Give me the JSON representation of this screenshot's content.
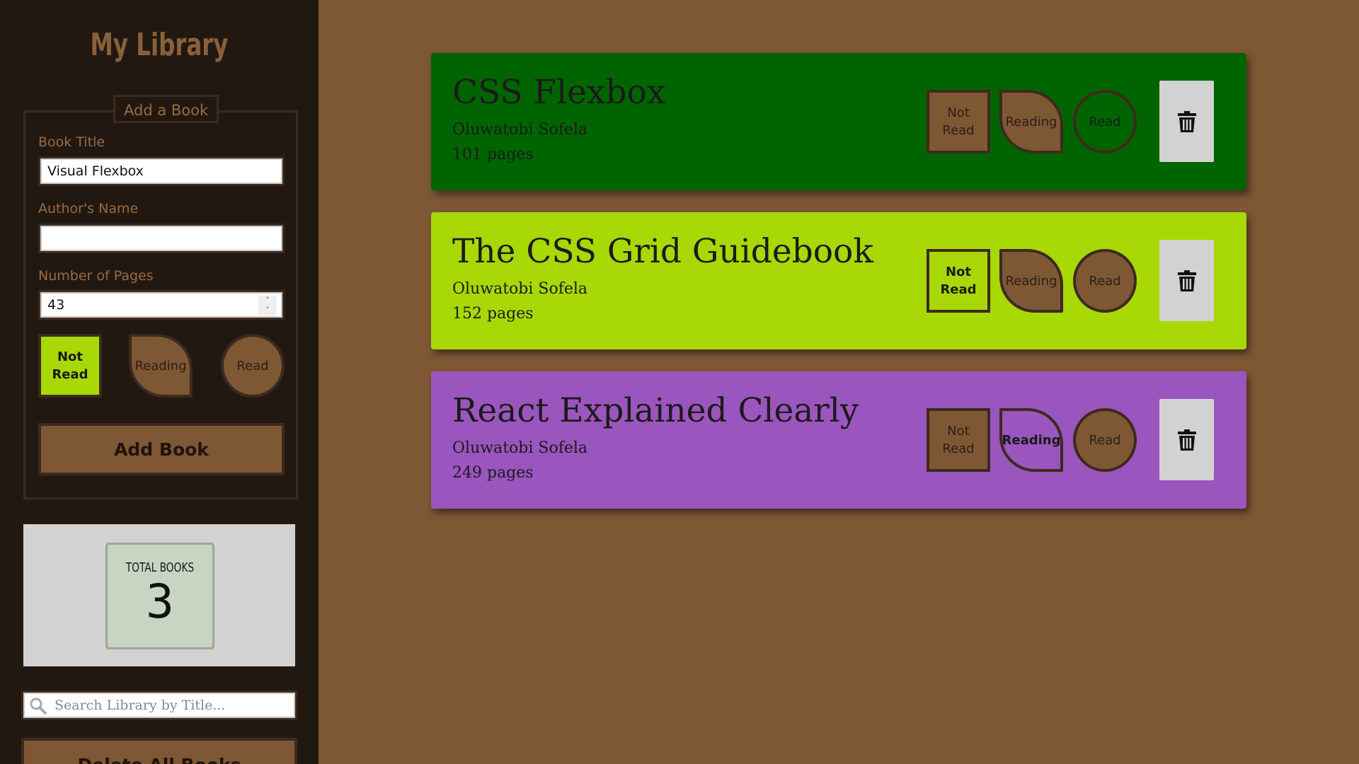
{
  "sidebar": {
    "title": "My Library",
    "form": {
      "legend": "Add a Book",
      "title_label": "Book Title",
      "title_value": "Visual Flexbox",
      "author_label": "Author's Name",
      "author_value": "",
      "pages_label": "Number of Pages",
      "pages_value": "43",
      "status_options": [
        "Not Read",
        "Reading",
        "Read"
      ],
      "selected_status": "Not Read",
      "add_button": "Add Book"
    },
    "counter": {
      "label": "TOTAL BOOKS",
      "value": "3"
    },
    "search": {
      "placeholder": "Search Library by Title..."
    },
    "delete_all_button": "Delete All Books"
  },
  "books": [
    {
      "title": "CSS Flexbox",
      "author": "Oluwatobi Sofela",
      "pages": "101 pages",
      "status": "Read",
      "color": "#006400"
    },
    {
      "title": "The CSS Grid Guidebook",
      "author": "Oluwatobi Sofela",
      "pages": "152 pages",
      "status": "Not Read",
      "color": "#a8d806"
    },
    {
      "title": "React Explained Clearly",
      "author": "Oluwatobi Sofela",
      "pages": "249 pages",
      "status": "Reading",
      "color": "#9b55be"
    }
  ],
  "status_labels": {
    "not_read": "Not Read",
    "reading": "Reading",
    "read": "Read"
  },
  "colors": {
    "sidebar_bg": "#221812",
    "page_bg": "#7e5735",
    "accent_active": "#a8d806",
    "trash_bg": "#d2d2d2"
  },
  "icons": {
    "trash": "trash-icon",
    "search": "search-icon"
  }
}
